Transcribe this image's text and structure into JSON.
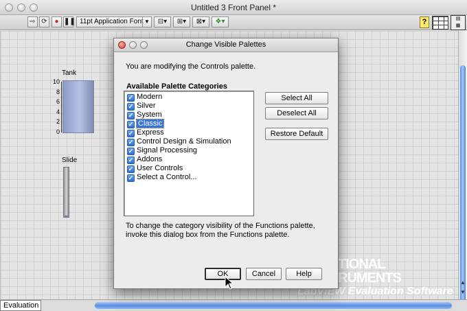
{
  "window": {
    "title": "Untitled 3 Front Panel *"
  },
  "toolbar": {
    "font_select": "11pt Application Font",
    "help_symbol": "?"
  },
  "panel": {
    "tank": {
      "label": "Tank",
      "scale": [
        "10",
        "8",
        "6",
        "4",
        "2",
        "0"
      ]
    },
    "slide": {
      "label": "Slide"
    }
  },
  "watermark": {
    "line1": "TIONAL",
    "line2": "RUMENTS",
    "line3": "LabVIEW Evaluation Software"
  },
  "status": {
    "evaluation": "Evaluation"
  },
  "dialog": {
    "title": "Change Visible Palettes",
    "modify_text": "You are modifying the Controls palette.",
    "group_label": "Available Palette Categories",
    "items": [
      {
        "label": "Modern",
        "checked": true
      },
      {
        "label": "Silver",
        "checked": true
      },
      {
        "label": "System",
        "checked": true
      },
      {
        "label": "Classic",
        "checked": true,
        "selected": true
      },
      {
        "label": "Express",
        "checked": true
      },
      {
        "label": "Control Design & Simulation",
        "checked": true
      },
      {
        "label": "Signal Processing",
        "checked": true
      },
      {
        "label": "Addons",
        "checked": true
      },
      {
        "label": "User Controls",
        "checked": true
      },
      {
        "label": "Select a Control...",
        "checked": true
      }
    ],
    "buttons": {
      "select_all": "Select All",
      "deselect_all": "Deselect All",
      "restore_default": "Restore Default",
      "ok": "OK",
      "cancel": "Cancel",
      "help": "Help"
    },
    "note_line1": "To change the category visibility of the Functions palette,",
    "note_line2": "invoke this dialog box from the Functions palette."
  },
  "colors": {
    "selection": "#3875d7",
    "scroll_accent": "#5b8fe0"
  }
}
